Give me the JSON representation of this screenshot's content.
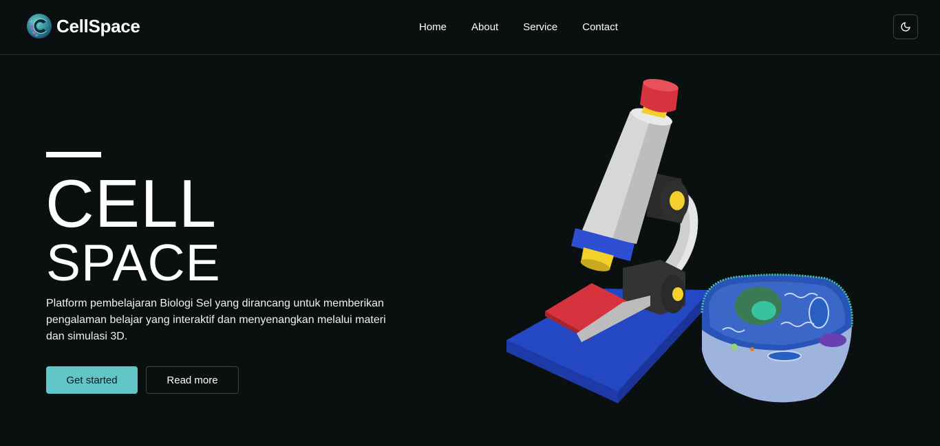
{
  "brand": {
    "name": "CellSpace",
    "logo_icon": "cell-logo-icon"
  },
  "nav": {
    "items": [
      {
        "label": "Home"
      },
      {
        "label": "About"
      },
      {
        "label": "Service"
      },
      {
        "label": "Contact"
      }
    ],
    "theme_toggle_icon": "moon-icon"
  },
  "hero": {
    "title_line1": "CELL",
    "title_line2": "SPACE",
    "description": "Platform pembelajaran Biologi Sel yang dirancang untuk memberikan pengalaman belajar yang interaktif dan menyenangkan melalui materi dan simulasi 3D.",
    "primary_button": "Get started",
    "secondary_button": "Read more",
    "illustration": "microscope-and-cell-3d-illustration"
  },
  "colors": {
    "background": "#0a0f0f",
    "accent": "#62c6c8",
    "border": "#2a3131"
  }
}
